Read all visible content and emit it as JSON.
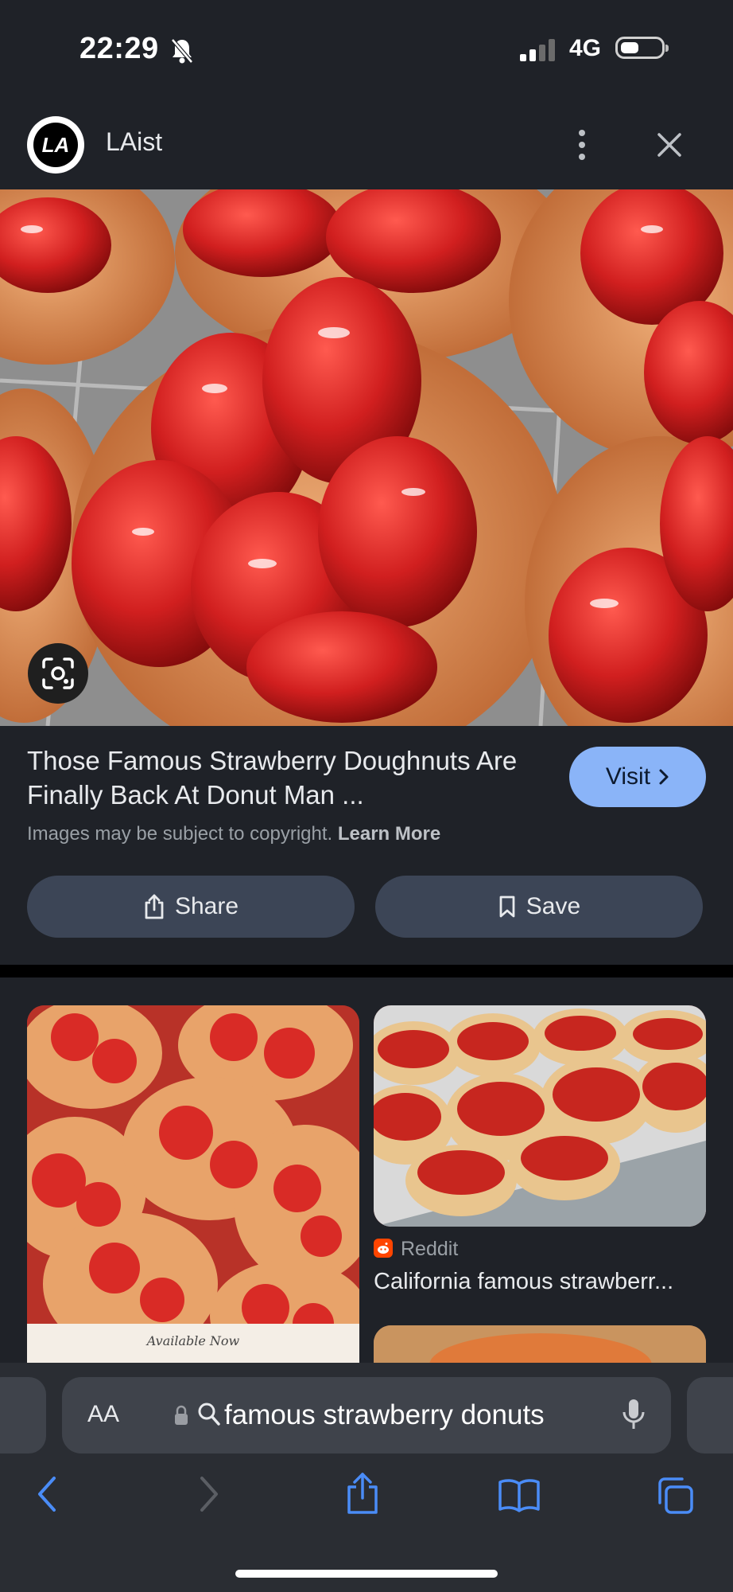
{
  "status_bar": {
    "time": "22:29",
    "network": "4G"
  },
  "header": {
    "logo_text": "LA",
    "site_name": "LAist"
  },
  "result": {
    "title": "Those Famous Strawberry Doughnuts Are Finally Back At Donut Man ...",
    "visit_label": "Visit",
    "copyright_text": "Images may be subject to copyright.",
    "learn_more": "Learn More",
    "share_label": "Share",
    "save_label": "Save"
  },
  "related": [
    {
      "source": "Reddit",
      "title": "California famous strawberr..."
    }
  ],
  "thumb1_caption": "Available Now",
  "browser": {
    "aa_label": "AA",
    "search_query": "famous strawberry donuts"
  },
  "colors": {
    "accent": "#8ab4f8",
    "background": "#1f2228",
    "button": "#3c4556",
    "ios_blue": "#4a8cf7"
  }
}
